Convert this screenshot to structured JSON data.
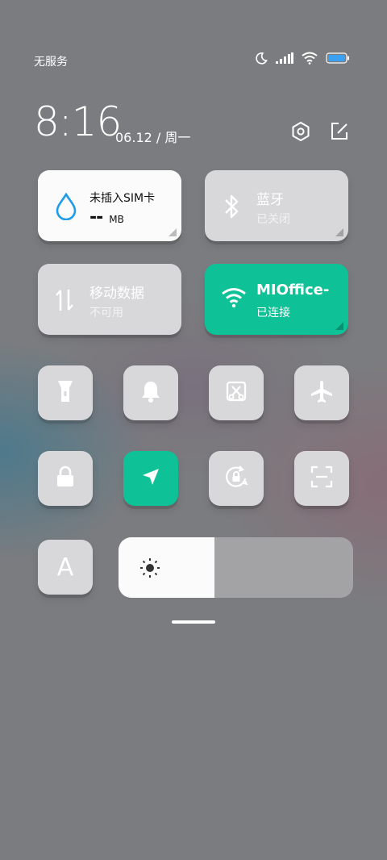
{
  "status_bar": {
    "carrier": "无服务",
    "icons": [
      "moon-icon",
      "signal-icon",
      "wifi-icon",
      "battery-icon"
    ],
    "battery_color": "#3aa0f0"
  },
  "header": {
    "time": "8:16",
    "date": "06.12 / 周一",
    "actions": [
      "settings-icon",
      "edit-icon"
    ]
  },
  "tiles": {
    "data": {
      "title": "未插入SIM卡",
      "value": "--",
      "unit": "MB",
      "icon": "water-drop-icon"
    },
    "bluetooth": {
      "title": "蓝牙",
      "status": "已关闭",
      "icon": "bluetooth-icon"
    },
    "mobile_data": {
      "title": "移动数据",
      "status": "不可用",
      "icon": "mobile-data-icon"
    },
    "wifi": {
      "title": "MIOffice-",
      "status": "已连接",
      "icon": "wifi-icon",
      "color": "#0fc197"
    }
  },
  "toggles_row1": [
    "flashlight-icon",
    "bell-icon",
    "screenshot-icon",
    "airplane-icon"
  ],
  "toggles_row2": [
    "lock-icon",
    "location-icon",
    "rotation-lock-icon",
    "scan-icon"
  ],
  "font_toggle": {
    "label": "A"
  },
  "brightness": {
    "level": 0.41,
    "icon": "sun-icon"
  }
}
